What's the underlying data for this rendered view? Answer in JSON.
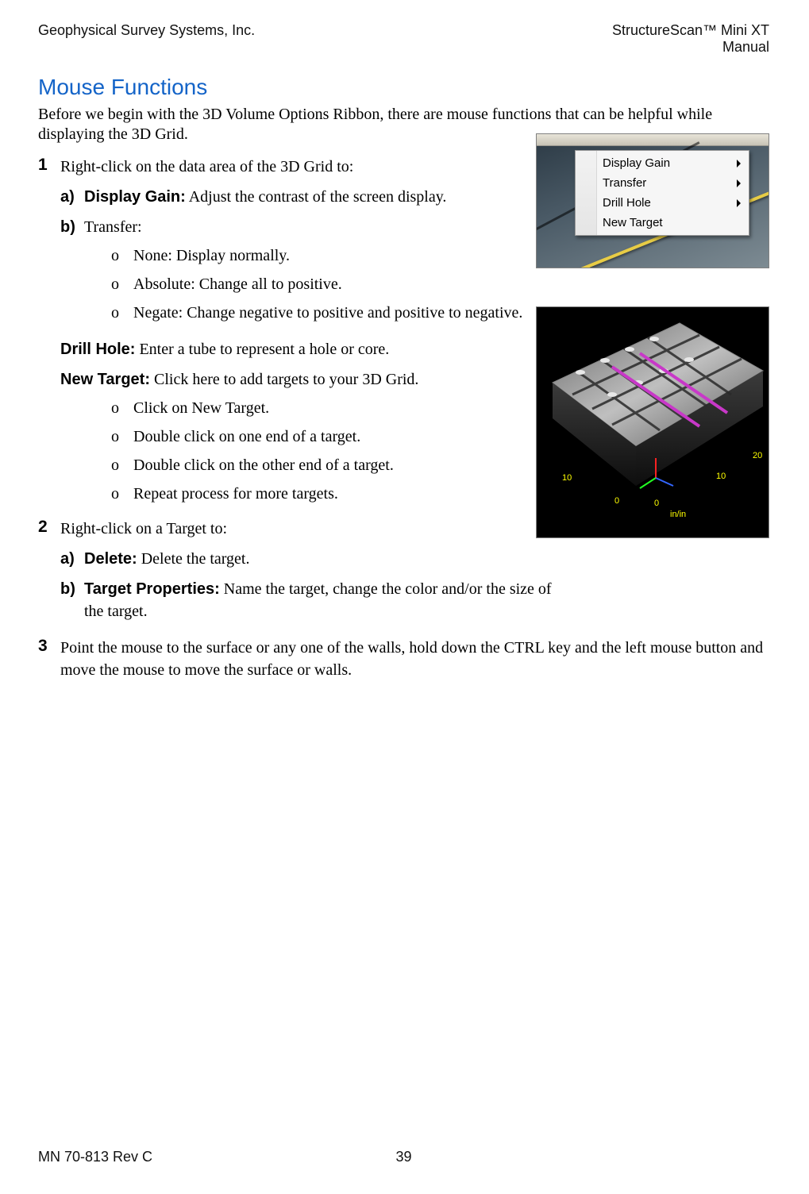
{
  "header": {
    "left": "Geophysical Survey Systems, Inc.",
    "right_line1": "StructureScan™ Mini XT",
    "right_line2": "Manual"
  },
  "section_title": "Mouse Functions",
  "intro": "Before we begin with the 3D Volume Options Ribbon, there are mouse functions that can be helpful while displaying the 3D Grid.",
  "items": [
    {
      "num": "1",
      "lead": "Right-click on the data area of the 3D Grid to:",
      "sub_alpha": [
        {
          "marker": "a)",
          "bold": "Display Gain:",
          "text": " Adjust the contrast of the screen display."
        },
        {
          "marker": "b)",
          "plain_lead": "Transfer:",
          "circles": [
            "None: Display normally.",
            "Absolute: Change all to positive.",
            "Negate: Change negative to positive and positive to negative."
          ]
        }
      ],
      "extra_labels": [
        {
          "bold": "Drill Hole:",
          "text": " Enter a tube to represent a hole or core."
        },
        {
          "bold": "New Target:",
          "text": " Click here to add targets to your 3D Grid.",
          "circles": [
            "Click on New Target.",
            "Double click on one end of a target.",
            "Double click on the other end of a target.",
            "Repeat process for more targets."
          ]
        }
      ]
    },
    {
      "num": "2",
      "lead": "Right-click on a Target to:",
      "sub_alpha": [
        {
          "marker": "a)",
          "bold": "Delete:",
          "text": " Delete the target."
        },
        {
          "marker": "b)",
          "bold": "Target Properties:",
          "text": " Name the target, change the color and/or the size of the target."
        }
      ]
    },
    {
      "num": "3",
      "lead": "Point the mouse to the surface or any one of the walls, hold down the CTRL key and the left mouse button and move the mouse to move the surface or walls."
    }
  ],
  "fig1_menu": {
    "items": [
      {
        "label": "Display Gain",
        "arrow": true
      },
      {
        "label": "Transfer",
        "arrow": true
      },
      {
        "label": "Drill Hole",
        "arrow": true
      },
      {
        "label": "New Target",
        "arrow": false
      }
    ]
  },
  "fig2_axis": {
    "x_near": "0",
    "x_far": "10",
    "y_near": "0",
    "y_far": "10",
    "y_far2": "20",
    "unit": "in/in"
  },
  "footer": {
    "left": "MN 70-813 Rev C",
    "page": "39"
  },
  "glyph_circle": "o"
}
